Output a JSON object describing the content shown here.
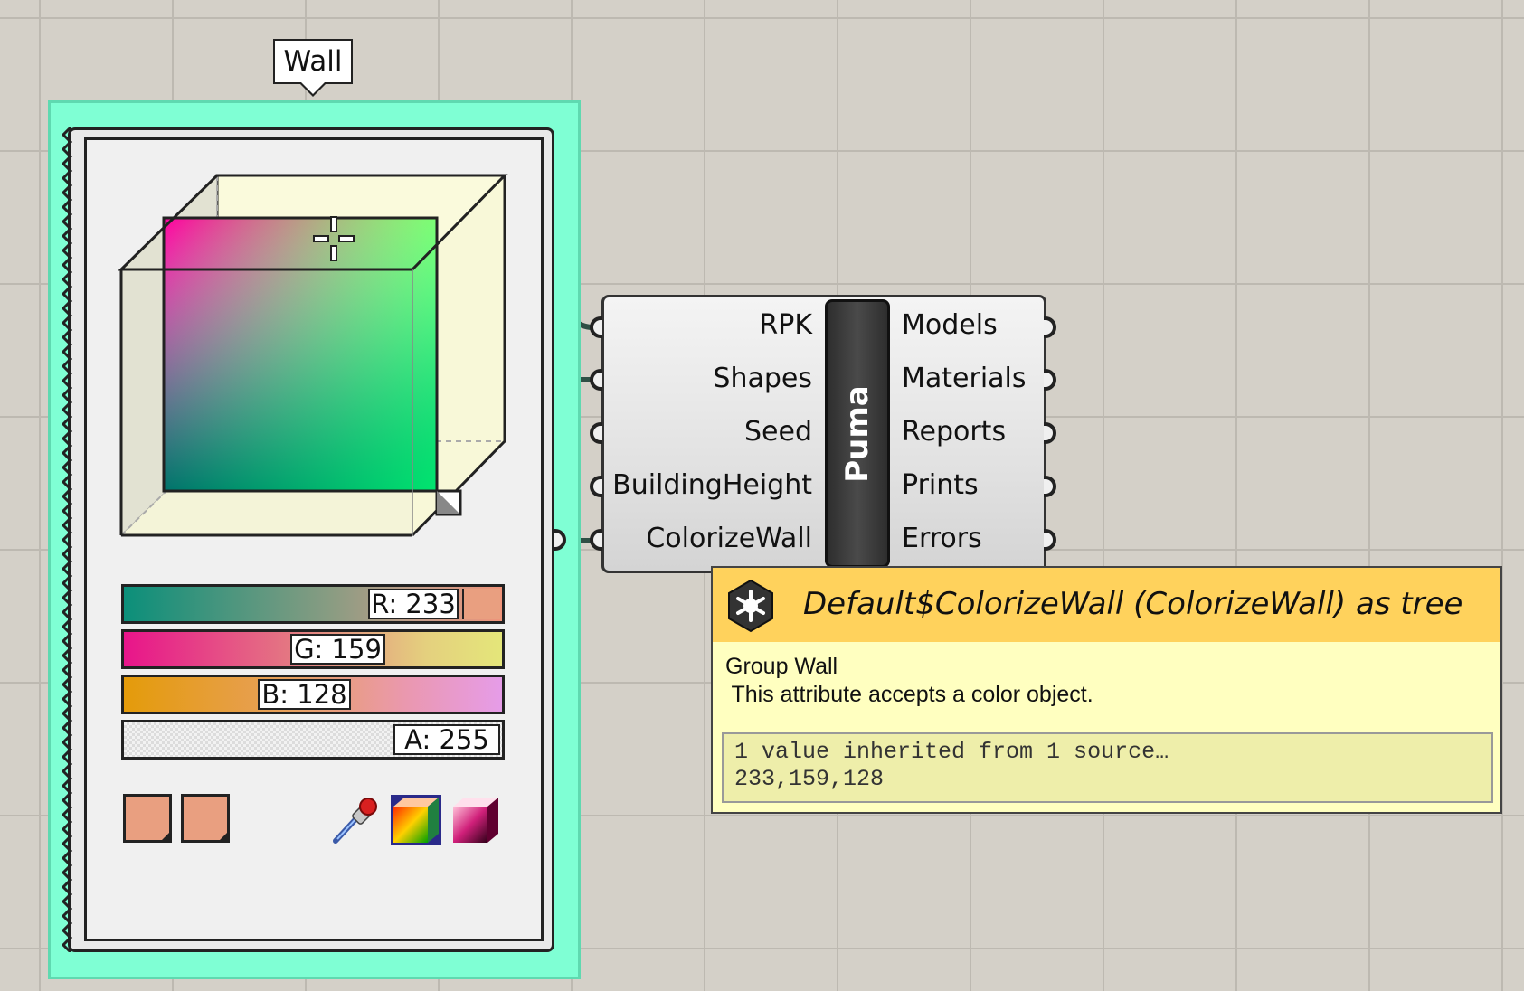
{
  "group": {
    "label": "Wall",
    "color": "#7fffd4"
  },
  "color_swatch": {
    "current_color": "#e99f80",
    "sliders": {
      "r_label": "R: 233",
      "g_label": "G: 159",
      "b_label": "B: 128",
      "a_label": "A: 255"
    },
    "r": 233,
    "g": 159,
    "b": 128,
    "a": 255,
    "tool_icons": [
      "eyedropper-icon",
      "rgb-cube-icon",
      "hue-cube-icon"
    ]
  },
  "component": {
    "name": "Puma",
    "inputs": [
      "RPK",
      "Shapes",
      "Seed",
      "BuildingHeight",
      "ColorizeWall"
    ],
    "outputs": [
      "Models",
      "Materials",
      "Reports",
      "Prints",
      "Errors"
    ]
  },
  "tooltip": {
    "title": "Default$ColorizeWall (ColorizeWall) as tree",
    "body_line1": "Group Wall",
    "body_line2": " This attribute accepts a color object.",
    "value_line1": "1 value inherited from 1 source…",
    "value_line2": "233,159,128",
    "header_color": "#ffd25c"
  }
}
